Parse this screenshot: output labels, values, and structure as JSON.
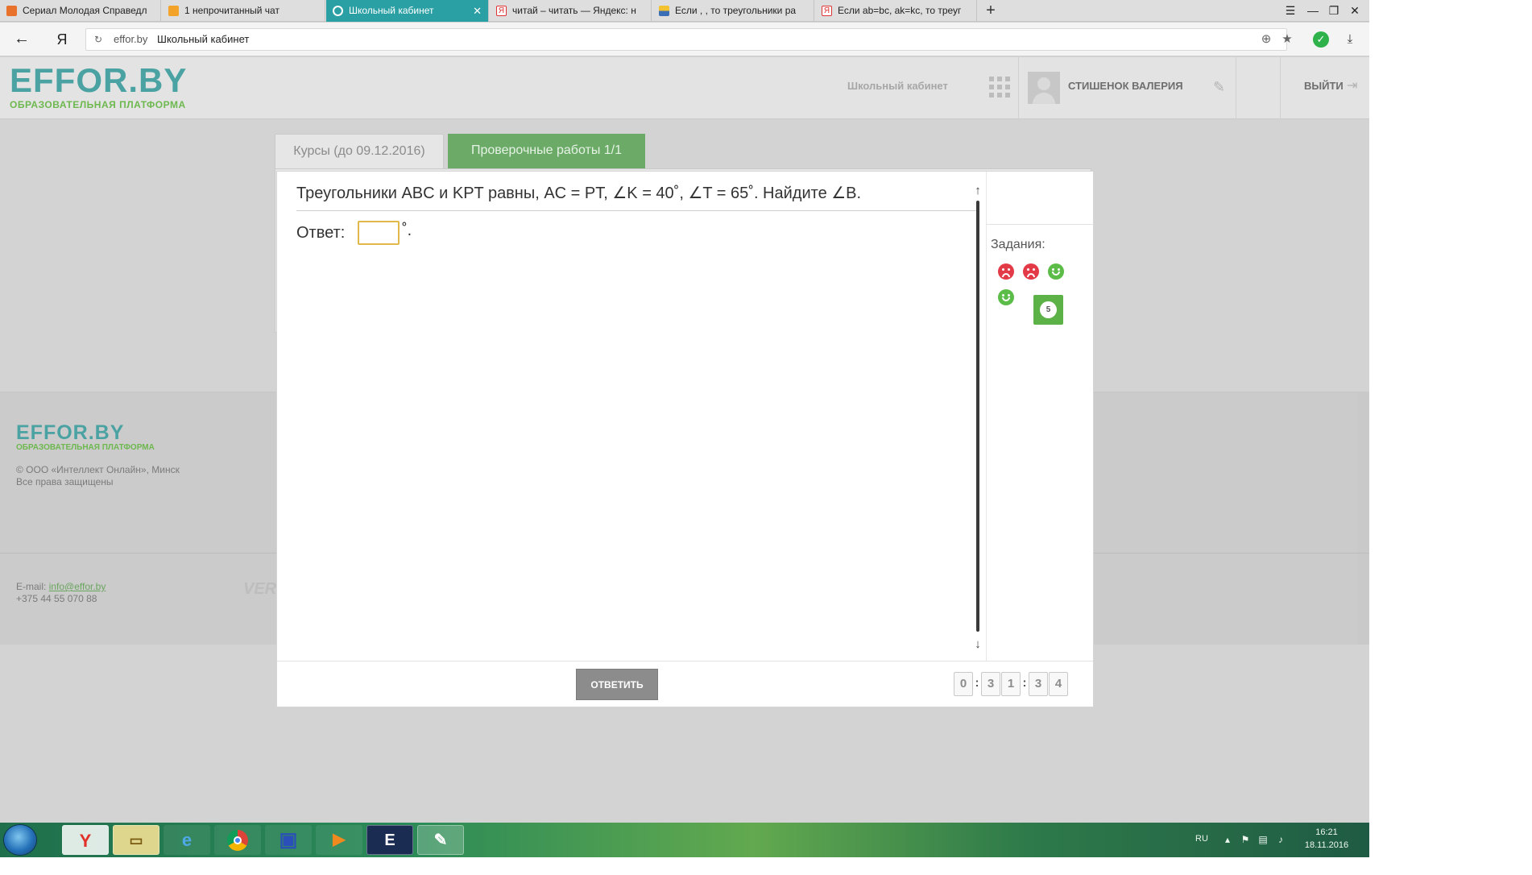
{
  "browser": {
    "tabs": [
      {
        "title": "Сериал Молодая Справедл",
        "active": false,
        "icon": "video-icon"
      },
      {
        "title": "1 непрочитанный чат",
        "active": false,
        "icon": "mail-icon"
      },
      {
        "title": "Школьный кабинет",
        "active": true,
        "icon": "check-circle-icon"
      },
      {
        "title": "читай – читать — Яндекс: н",
        "active": false,
        "icon": "yandex-icon"
      },
      {
        "title": "Если , , то треугольники ра",
        "active": false,
        "icon": "image-icon"
      },
      {
        "title": "Если ab=bc, ak=kc, то треуг",
        "active": false,
        "icon": "yandex-icon"
      }
    ],
    "new_tab": "+",
    "back": "←",
    "yandex_button": "Я",
    "address": {
      "domain": "effor.by",
      "title": "Школьный кабинет"
    }
  },
  "site": {
    "logo": "EFFOR.BY",
    "logo_subtitle": "ОБРАЗОВАТЕЛЬНАЯ ПЛАТФОРМА",
    "nav_school": "Школьный кабинет",
    "user_name": "СТИШЕНОК ВАЛЕРИЯ",
    "logout": "ВЫЙТИ"
  },
  "page_tabs": {
    "courses": "Курсы (до 09.12.2016)",
    "tests": "Проверочные работы 1/1"
  },
  "footer": {
    "logo": "EFFOR.BY",
    "logo_subtitle": "ОБРАЗОВАТЕЛЬНАЯ ПЛАТФОРМА",
    "copyright": "© ООО «Интеллект Онлайн», Минск",
    "rights": "Все права защищены",
    "email_label": "E-mail:",
    "email": "info@effor.by",
    "phone": "+375 44 55 070 88",
    "verified": "VERI"
  },
  "quiz": {
    "question": "Треугольники ABC и KPT равны, AC = PT, ∠K = 40˚, ∠T = 65˚. Найдите ∠B.",
    "answer_label": "Ответ:",
    "answer_value": "",
    "answer_suffix": "˚.",
    "tasks_label": "Задания:",
    "tasks": [
      {
        "status": "wrong"
      },
      {
        "status": "wrong"
      },
      {
        "status": "correct"
      },
      {
        "status": "correct"
      },
      {
        "status": "current",
        "number": "5"
      }
    ],
    "submit": "ОТВЕТИТЬ",
    "timer_digits": [
      "0",
      "3",
      "1",
      "3",
      "4"
    ],
    "timer_separator": ":",
    "scroll_up": "↑",
    "scroll_down": "↓"
  },
  "taskbar": {
    "lang": "RU",
    "time": "16:21",
    "date": "18.11.2016"
  },
  "colors": {
    "accent_teal": "#2aa0a4",
    "brand_green": "#6bab67",
    "wrong_red": "#e33a47",
    "correct_green": "#5cbc48",
    "input_border": "#e0b94a"
  }
}
